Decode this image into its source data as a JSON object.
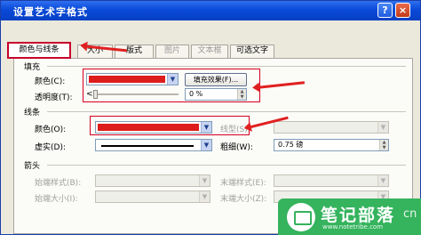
{
  "window": {
    "title": "设置艺术字格式",
    "help_label": "?",
    "close_label": "×"
  },
  "tabs": [
    {
      "label": "颜色与线条",
      "active": true,
      "enabled": true
    },
    {
      "label": "大小",
      "active": false,
      "enabled": true
    },
    {
      "label": "版式",
      "active": false,
      "enabled": true
    },
    {
      "label": "图片",
      "active": false,
      "enabled": false
    },
    {
      "label": "文本框",
      "active": false,
      "enabled": false
    },
    {
      "label": "可选文字",
      "active": false,
      "enabled": true
    }
  ],
  "fill": {
    "group_label": "填充",
    "color_label": "颜色(C):",
    "color_value": "#dd1c1c",
    "effects_button": "填充效果(F)...",
    "transparency_label": "透明度(T):",
    "transparency_left": "<",
    "transparency_value": "0 %",
    "transparency_fraction": 0
  },
  "line": {
    "group_label": "线条",
    "color_label": "颜色(O):",
    "color_value": "#dd1c1c",
    "style_label": "线型(S):",
    "dash_label": "虚实(D):",
    "weight_label": "粗细(W):",
    "weight_value": "0.75 磅"
  },
  "arrows": {
    "group_label": "箭头",
    "begin_style_label": "始端样式(B):",
    "end_style_label": "末端样式(E):",
    "begin_size_label": "始端大小(I):",
    "end_size_label": "末端大小(Z):"
  },
  "watermark": {
    "title": "笔记部落",
    "url": "www.notetribe.com",
    "suffix": "cn"
  },
  "colors": {
    "accent_red": "#dd1c1c",
    "title_blue": "#0a4ad8",
    "watermark_green": "#35b35d"
  }
}
